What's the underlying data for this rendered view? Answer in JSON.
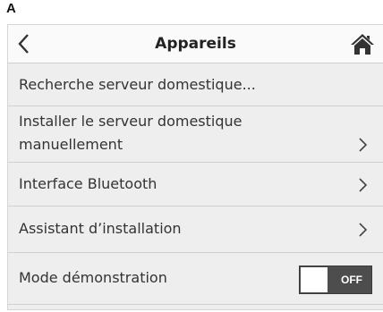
{
  "figure_label": "A",
  "header": {
    "title": "Appareils",
    "back_icon": "chevron-left-icon",
    "home_icon": "home-icon"
  },
  "menu": {
    "items": [
      {
        "label": "Recherche serveur domestique...",
        "has_chevron": false
      },
      {
        "label_line1": "Installer le serveur domestique",
        "label_line2": "manuellement",
        "has_chevron": true,
        "chevron_icon": "chevron-right-icon"
      },
      {
        "label": "Interface Bluetooth",
        "has_chevron": true,
        "chevron_icon": "chevron-right-icon"
      },
      {
        "label": "Assistant d’installation",
        "has_chevron": true,
        "chevron_icon": "chevron-right-icon"
      },
      {
        "label": "Mode démonstration",
        "toggle": {
          "state": "OFF",
          "on": false
        }
      }
    ]
  },
  "colors": {
    "background": "#eeeeee",
    "header": "#fafafa",
    "toggle_off": "#4d4d4d",
    "text": "#333333"
  }
}
